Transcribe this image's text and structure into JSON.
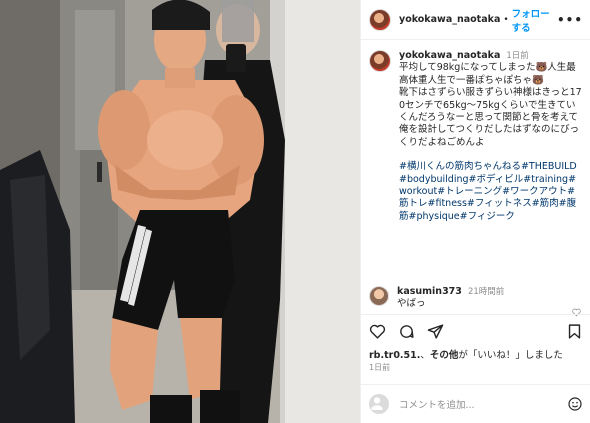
{
  "post": {
    "author": "yokokawa_naotaka",
    "follow_label": "フォローする",
    "more_label": "•••",
    "photo_alt": "",
    "caption": {
      "user": "yokokawa_naotaka",
      "time": "1日前",
      "paragraph1": "平均して98kgになってしまった🐻人生最高体重人生で一番ぽちゃぽちゃ🐻",
      "paragraph2": "靴下はさずらい服きずらい神様はきっと170センチで65kg〜75kgくらいで生きていくんだろうなーと思って関節と骨を考えて俺を設計してつくりだしたはずなのにびっくりだよねごめんよ",
      "hashtags": "#横川くんの筋肉ちゃんねる#THEBUILD#bodybuilding#ボディビル#training#workout#トレーニング#ワークアウト#筋トレ#fitness#フィットネス#筋肉#腹筋#physique#フィジーク"
    },
    "comment": {
      "user": "kasumin373",
      "time": "21時間前",
      "text": "やばっ"
    },
    "likes": {
      "user": "rb.tr0.51.",
      "rest": "その他",
      "phrase": "が「いいね！」しました"
    },
    "date": "1日前",
    "comment_input": {
      "placeholder": "コメントを追加..."
    }
  },
  "colors": {
    "link": "#0095f6",
    "hashtag": "#00376b",
    "muted": "#8e8e8e"
  }
}
